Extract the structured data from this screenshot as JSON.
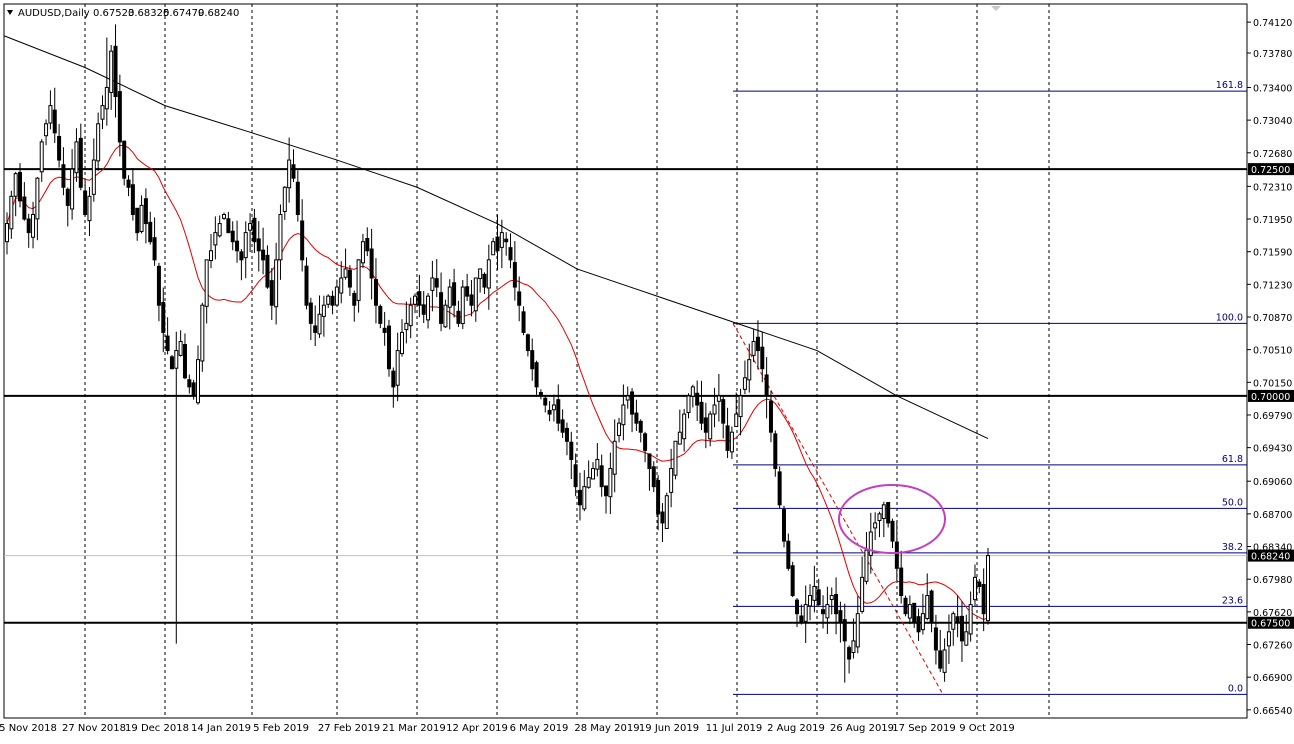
{
  "header": {
    "symbol": "AUDUSD,Daily",
    "open": "0.67523",
    "high": "0.68325",
    "low": "0.67479",
    "close": "0.68240"
  },
  "colors": {
    "candle": "#000000",
    "fib": "#000080",
    "ma_fast": "#e00000",
    "ma_slow": "#000000",
    "ellipse": "#c040c0",
    "grid": "#000000"
  },
  "chart_data": {
    "type": "candlestick",
    "title": "AUDUSD,Daily",
    "ylim": [
      0.6645,
      0.7432
    ],
    "grid": true,
    "y_ticks": [
      "0.74120",
      "0.73780",
      "0.73400",
      "0.73040",
      "0.72680",
      "0.72310",
      "0.71950",
      "0.71590",
      "0.71230",
      "0.70870",
      "0.70510",
      "0.70150",
      "0.69790",
      "0.69430",
      "0.69060",
      "0.68700",
      "0.68340",
      "0.67980",
      "0.67620",
      "0.67260",
      "0.66900",
      "0.66540"
    ],
    "x_ticks": [
      "5 Nov 2018",
      "27 Nov 2018",
      "19 Dec 2018",
      "14 Jan 2019",
      "5 Feb 2019",
      "27 Feb 2019",
      "21 Mar 2019",
      "12 Apr 2019",
      "6 May 2019",
      "28 May 2019",
      "19 Jun 2019",
      "11 Jul 2019",
      "2 Aug 2019",
      "26 Aug 2019",
      "17 Sep 2019",
      "9 Oct 2019"
    ],
    "current_price": "0.68240",
    "horizontal_levels": [
      {
        "price": 0.725,
        "label": "0.72500"
      },
      {
        "price": 0.7,
        "label": "0.70000"
      },
      {
        "price": 0.675,
        "label": "0.67500"
      }
    ],
    "fibonacci": {
      "high": 0.708,
      "low": 0.6671,
      "levels": [
        {
          "label": "161.8",
          "price": 0.7336
        },
        {
          "label": "100.0",
          "price": 0.708
        },
        {
          "label": "61.8",
          "price": 0.6924
        },
        {
          "label": "50.0",
          "price": 0.6876
        },
        {
          "label": "38.2",
          "price": 0.6827
        },
        {
          "label": "23.6",
          "price": 0.6768
        },
        {
          "label": "0.0",
          "price": 0.6671
        }
      ]
    },
    "closes": [
      0.719,
      0.722,
      0.7245,
      0.7215,
      0.7195,
      0.718,
      0.72,
      0.724,
      0.728,
      0.73,
      0.732,
      0.729,
      0.726,
      0.723,
      0.721,
      0.725,
      0.728,
      0.723,
      0.72,
      0.722,
      0.726,
      0.73,
      0.732,
      0.734,
      0.738,
      0.733,
      0.728,
      0.724,
      0.723,
      0.72,
      0.718,
      0.721,
      0.719,
      0.717,
      0.715,
      0.71,
      0.707,
      0.705,
      0.703,
      0.705,
      0.706,
      0.702,
      0.701,
      0.7,
      0.704,
      0.71,
      0.715,
      0.716,
      0.718,
      0.719,
      0.72,
      0.718,
      0.717,
      0.716,
      0.715,
      0.718,
      0.719,
      0.717,
      0.716,
      0.715,
      0.712,
      0.71,
      0.715,
      0.72,
      0.723,
      0.726,
      0.724,
      0.72,
      0.715,
      0.71,
      0.708,
      0.707,
      0.709,
      0.71,
      0.711,
      0.71,
      0.712,
      0.713,
      0.714,
      0.712,
      0.71,
      0.715,
      0.717,
      0.716,
      0.713,
      0.71,
      0.708,
      0.707,
      0.703,
      0.701,
      0.705,
      0.707,
      0.708,
      0.71,
      0.711,
      0.71,
      0.709,
      0.711,
      0.713,
      0.712,
      0.708,
      0.71,
      0.712,
      0.71,
      0.708,
      0.712,
      0.711,
      0.71,
      0.713,
      0.714,
      0.712,
      0.715,
      0.717,
      0.716,
      0.718,
      0.717,
      0.715,
      0.712,
      0.71,
      0.707,
      0.705,
      0.703,
      0.701,
      0.7,
      0.699,
      0.698,
      0.699,
      0.697,
      0.696,
      0.695,
      0.693,
      0.69,
      0.688,
      0.69,
      0.691,
      0.692,
      0.693,
      0.69,
      0.689,
      0.692,
      0.695,
      0.697,
      0.699,
      0.7,
      0.698,
      0.697,
      0.696,
      0.694,
      0.692,
      0.69,
      0.687,
      0.686,
      0.689,
      0.692,
      0.695,
      0.696,
      0.698,
      0.7,
      0.701,
      0.699,
      0.697,
      0.696,
      0.698,
      0.699,
      0.7,
      0.697,
      0.694,
      0.696,
      0.698,
      0.7,
      0.702,
      0.704,
      0.706,
      0.705,
      0.703,
      0.7,
      0.696,
      0.692,
      0.688,
      0.684,
      0.681,
      0.678,
      0.676,
      0.675,
      0.677,
      0.678,
      0.679,
      0.677,
      0.676,
      0.677,
      0.678,
      0.676,
      0.675,
      0.673,
      0.671,
      0.673,
      0.676,
      0.68,
      0.683,
      0.685,
      0.686,
      0.687,
      0.688,
      0.686,
      0.684,
      0.681,
      0.678,
      0.676,
      0.677,
      0.675,
      0.674,
      0.676,
      0.678,
      0.675,
      0.672,
      0.67,
      0.672,
      0.674,
      0.676,
      0.675,
      0.673,
      0.674,
      0.677,
      0.68,
      0.679,
      0.676,
      0.6824
    ]
  }
}
